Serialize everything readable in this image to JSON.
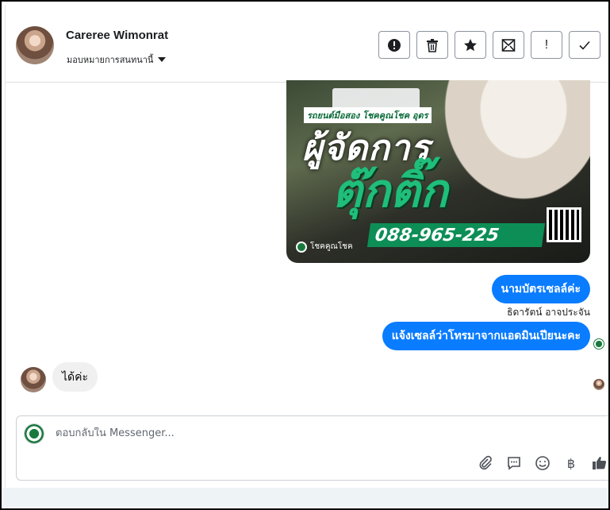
{
  "header": {
    "contact_name": "Careree Wimonrat",
    "assign_label": "มอบหมายการสนทนานี้",
    "toolbar": {
      "mark_spam": "❗",
      "delete": "🗑",
      "star": "★",
      "move_to_inbox": "✉",
      "important": "!",
      "done": "✓"
    }
  },
  "attachment": {
    "tag_text": "รถยนต์มือสอง โชคคูณโชค อุดร",
    "headline_1": "ผู้จัดการ",
    "headline_2": "ตุ๊กติ๊ก",
    "phone": "088-965-225",
    "logo_text": "โชคคูณโชค"
  },
  "messages": [
    {
      "direction": "out",
      "text": "นามบัตรเซลล์ค่ะ"
    },
    {
      "direction": "out",
      "text": "แจ้งเซลล์ว่าโทรมาจากแอดมินเปียนะคะ"
    },
    {
      "direction": "in",
      "text": "ได้ค่ะ"
    }
  ],
  "sender_label": "ธิดารัตน์ อาจประจัน",
  "composer": {
    "placeholder": "ตอบกลับใน Messenger...",
    "baht_icon": "฿"
  }
}
